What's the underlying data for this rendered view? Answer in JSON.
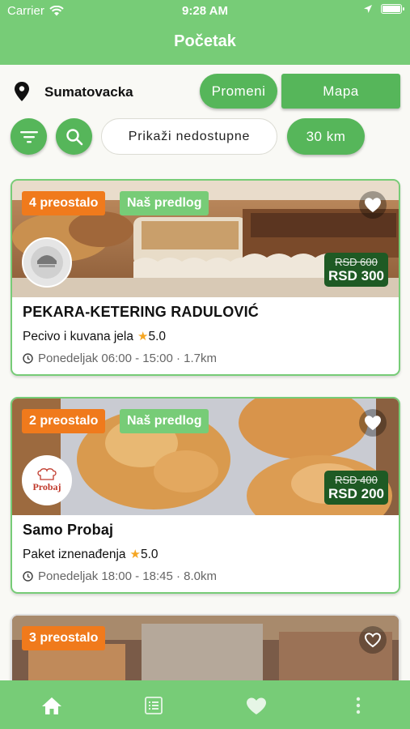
{
  "status_bar": {
    "carrier": "Carrier",
    "time": "9:28 AM"
  },
  "header": {
    "title": "Početak"
  },
  "location": {
    "name": "Sumatovacka",
    "change_label": "Promeni",
    "map_label": "Mapa"
  },
  "filters": {
    "show_unavailable_label": "Prikaži nedostupne",
    "distance_label": "30 km"
  },
  "cards": [
    {
      "remaining": "4 preostalo",
      "recommended": "Naš predlog",
      "old_price": "RSD 600",
      "new_price": "RSD 300",
      "name": "PEKARA-KETERING RADULOVIĆ",
      "category": "Pecivo i kuvana jela",
      "rating": "5.0",
      "hours": "Ponedeljak 06:00 - 15:00 · 1.7km"
    },
    {
      "remaining": "2 preostalo",
      "recommended": "Naš predlog",
      "old_price": "RSD 400",
      "new_price": "RSD 200",
      "name": "Samo Probaj",
      "category": "Paket iznenađenja",
      "rating": "5.0",
      "hours": "Ponedeljak 18:00 - 18:45 · 8.0km",
      "logo_text": "Probaj"
    },
    {
      "remaining": "3 preostalo"
    }
  ],
  "icons": {
    "location": "location-pin-icon",
    "filter": "filter-icon",
    "search": "search-icon",
    "favorite": "heart-icon",
    "clock": "clock-icon",
    "tabs": [
      "home-icon",
      "list-icon",
      "heart-icon",
      "more-icon"
    ]
  },
  "colors": {
    "primary": "#77cc77",
    "button": "#56b65a",
    "badge_orange": "#f07a1c",
    "price_bg": "#1e5a24"
  }
}
